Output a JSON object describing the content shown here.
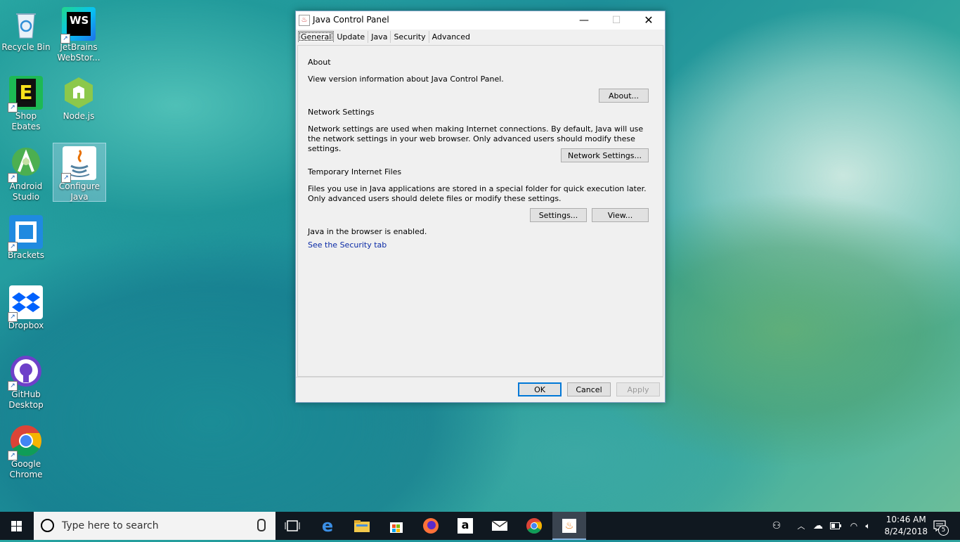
{
  "desktop": {
    "icons": [
      {
        "label": "Recycle Bin",
        "icon": "recycle-bin-icon"
      },
      {
        "label": "JetBrains WebStor...",
        "icon": "webstorm-icon",
        "badge": "WS"
      },
      {
        "label": "Shop Ebates",
        "icon": "ebates-icon",
        "badge": "E"
      },
      {
        "label": "Node.js",
        "icon": "nodejs-icon"
      },
      {
        "label": "Android Studio",
        "icon": "android-studio-icon"
      },
      {
        "label": "Configure Java",
        "icon": "java-icon"
      },
      {
        "label": "Brackets",
        "icon": "brackets-icon"
      },
      {
        "label": "Dropbox",
        "icon": "dropbox-icon"
      },
      {
        "label": "GitHub Desktop",
        "icon": "github-icon"
      },
      {
        "label": "Google Chrome",
        "icon": "chrome-icon"
      }
    ]
  },
  "window": {
    "title": "Java Control Panel",
    "tabs": [
      "General",
      "Update",
      "Java",
      "Security",
      "Advanced"
    ],
    "active_tab": "General",
    "about": {
      "title": "About",
      "text": "View version information about Java Control Panel.",
      "button": "About..."
    },
    "network": {
      "title": "Network Settings",
      "text": "Network settings are used when making Internet connections. By default, Java will use the network settings in your web browser. Only advanced users should modify these settings.",
      "button": "Network Settings..."
    },
    "temp_files": {
      "title": "Temporary Internet Files",
      "text": "Files you use in Java applications are stored in a special folder for quick execution later. Only advanced users should delete files or modify these settings.",
      "settings_button": "Settings...",
      "view_button": "View..."
    },
    "browser_status": "Java in the browser is enabled.",
    "security_link": "See the Security tab",
    "footer": {
      "ok": "OK",
      "cancel": "Cancel",
      "apply": "Apply"
    }
  },
  "taskbar": {
    "search_placeholder": "Type here to search",
    "time": "10:46 AM",
    "date": "8/24/2018",
    "notification_count": "5"
  }
}
